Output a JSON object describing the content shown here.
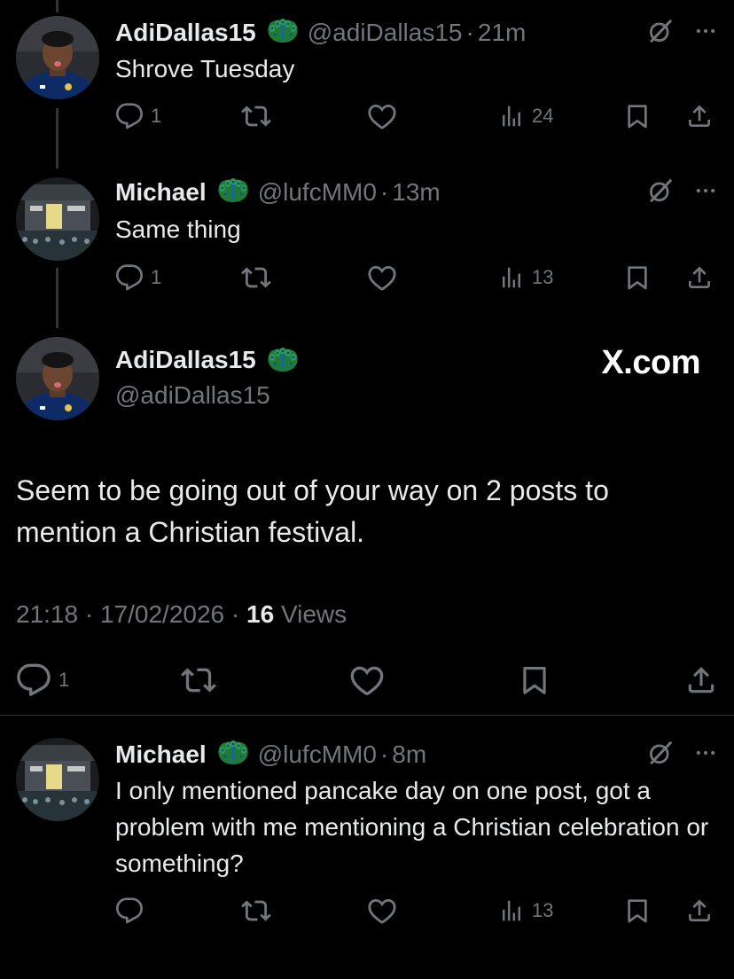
{
  "reply1": {
    "name": "AdiDallas15",
    "handle": "@adiDallas15",
    "sep": "·",
    "time": "21m",
    "text": "Shrove Tuesday",
    "reply_count": "1",
    "views": "24"
  },
  "reply2": {
    "name": "Michael",
    "handle": "@lufcMM0",
    "sep": "·",
    "time": "13m",
    "text": "Same thing",
    "reply_count": "1",
    "views": "13"
  },
  "main": {
    "name": "AdiDallas15",
    "handle": "@adiDallas15",
    "watermark": "X.com",
    "text": "Seem to be going out of your way on 2 posts to mention a Christian festival.",
    "time": "21:18",
    "sep1": "·",
    "date": "17/02/2026",
    "sep2": "·",
    "views_count": "16",
    "views_label": "Views",
    "reply_count": "1"
  },
  "reply3": {
    "name": "Michael",
    "handle": "@lufcMM0",
    "sep": "·",
    "time": "8m",
    "text": "I only mentioned pancake day on one post, got a problem with me mentioning a Christian celebration or something?",
    "views": "13"
  },
  "icons": {
    "emoji": "peacock-emoji",
    "reply": "reply-icon",
    "repost": "repost-icon",
    "like": "heart-icon",
    "views": "views-icon",
    "bookmark": "bookmark-icon",
    "share": "share-icon",
    "grok": "grok-icon",
    "more": "more-icon"
  },
  "colors": {
    "background": "#000000",
    "text": "#e7e9ea",
    "muted": "#71767b",
    "divider": "#2f3336"
  }
}
